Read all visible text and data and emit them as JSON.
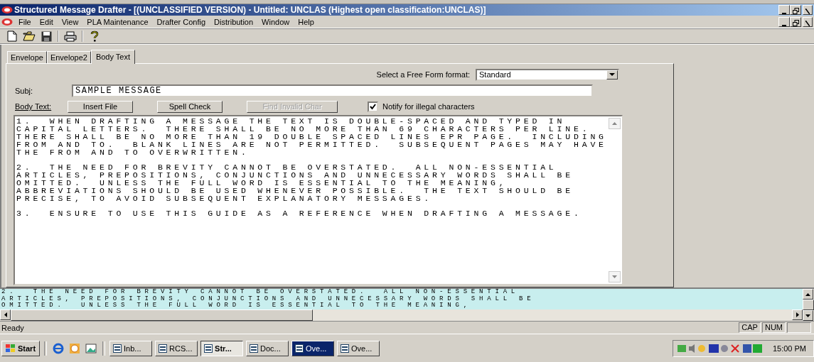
{
  "window": {
    "title": "Structured Message Drafter - [(UNCLASSIFIED VERSION) - Untitled: UNCLAS (Highest open classification:UNCLAS)]"
  },
  "menu": [
    "File",
    "Edit",
    "View",
    "PLA Maintenance",
    "Drafter Config",
    "Distribution",
    "Window",
    "Help"
  ],
  "tabs": [
    {
      "label": "Envelope",
      "selected": false
    },
    {
      "label": "Envelope2",
      "selected": false
    },
    {
      "label": "Body Text",
      "selected": true
    }
  ],
  "format": {
    "label": "Select a Free Form format:",
    "value": "Standard"
  },
  "subject": {
    "label": "Subj:",
    "value": "SAMPLE MESSAGE"
  },
  "body_label": "Body Text:",
  "buttons": [
    {
      "label": "Insert File",
      "disabled": false
    },
    {
      "label": "Spell Check",
      "disabled": false
    },
    {
      "label": "Find Invalid Char",
      "disabled": true
    }
  ],
  "notify": {
    "label": "Notify for illegal characters",
    "checked": true
  },
  "body": [
    "1.  WHEN DRAFTING A MESSAGE THE TEXT IS DOUBLE-SPACED AND TYPED IN\nCAPITAL LETTERS.  THERE SHALL BE NO MORE THAN 69 CHARACTERS PER LINE.\nTHERE SHALL BE NO MORE THAN 19 DOUBLE SPACED LINES EPR PAGE.  INCLUDING\nFROM AND TO.  BLANK LINES ARE NOT PERMITTED.  SUBSEQUENT PAGES MAY HAVE\nTHE FROM AND TO OVERWRITTEN.",
    "2.  THE NEED FOR BREVITY CANNOT BE OVERSTATED.  ALL NON-ESSENTIAL\nARTICLES, PREPOSITIONS, CONJUNCTIONS AND UNNECESSARY WORDS SHALL BE\nOMITTED.  UNLESS THE FULL WORD IS ESSENTIAL TO THE MEANING,\nABBREVIATIONS SHOULD BE USED WHENEVER POSSIBLE.  THE TEXT SHOULD BE\nPRECISE, TO AVOID SUBSEQUENT EXPLANATORY MESSAGES.",
    "3.  ENSURE TO USE THIS GUIDE AS A REFERENCE WHEN DRAFTING A MESSAGE."
  ],
  "preview": "2.  THE NEED FOR BREVITY CANNOT BE OVERSTATED.  ALL NON-ESSENTIAL\nARTICLES, PREPOSITIONS, CONJUNCTIONS AND UNNECESSARY WORDS SHALL BE\nOMITTED.  UNLESS THE FULL WORD IS ESSENTIAL TO THE MEANING,",
  "status_bar": {
    "text": "Ready",
    "indicators": [
      "CAP",
      "NUM"
    ]
  },
  "taskbar": {
    "start": "Start",
    "tasks": [
      {
        "label": "Inb...",
        "selected": false,
        "flashing": false
      },
      {
        "label": "RCS...",
        "selected": false,
        "flashing": false
      },
      {
        "label": "Str...",
        "selected": true,
        "flashing": false
      },
      {
        "label": "Doc...",
        "selected": false,
        "flashing": false
      },
      {
        "label": "Ove...",
        "selected": false,
        "flashing": true
      },
      {
        "label": "Ove...",
        "selected": false,
        "flashing": false
      }
    ],
    "clock": "15:00 PM"
  }
}
